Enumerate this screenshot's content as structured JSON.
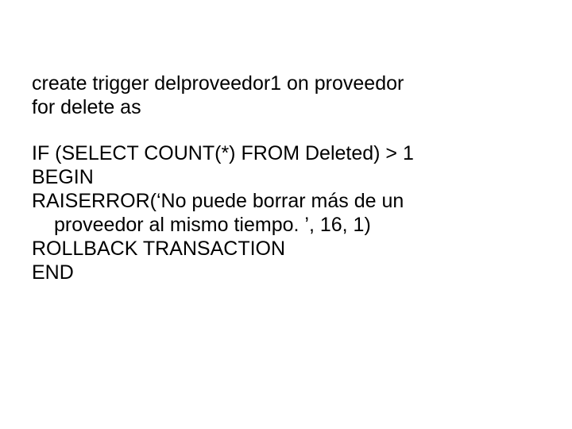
{
  "slide": {
    "block1": {
      "line1": "create trigger delproveedor1 on proveedor",
      "line2": "for delete as"
    },
    "block2": {
      "line1": "IF (SELECT COUNT(*) FROM Deleted) > 1",
      "line2": "BEGIN",
      "line3": "RAISERROR(‘No puede borrar más de un",
      "line4": "proveedor al mismo tiempo. ’, 16, 1)",
      "line5": "ROLLBACK TRANSACTION",
      "line6": "END"
    }
  }
}
